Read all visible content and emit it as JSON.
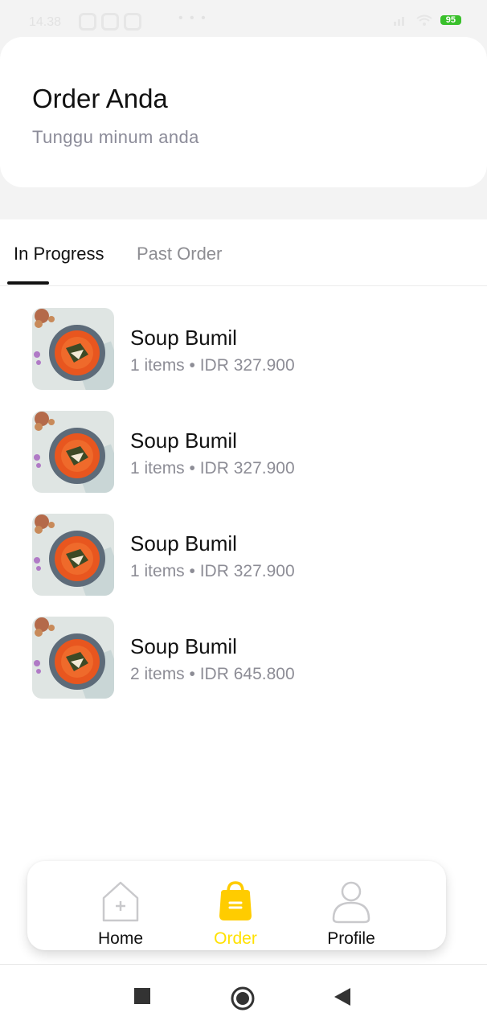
{
  "status_bar": {
    "time": "14.38",
    "overflow": "• • •",
    "battery_level": "95"
  },
  "header": {
    "title": "Order Anda",
    "subtitle": "Tunggu minum anda"
  },
  "tabs": [
    {
      "label": "In Progress",
      "active": true
    },
    {
      "label": "Past Order",
      "active": false
    }
  ],
  "orders": [
    {
      "name": "Soup Bumil",
      "meta": "1 items • IDR 327.900",
      "image": "soup-bowl-photo"
    },
    {
      "name": "Soup Bumil",
      "meta": "1 items • IDR 327.900",
      "image": "soup-bowl-photo"
    },
    {
      "name": "Soup Bumil",
      "meta": "1 items • IDR 327.900",
      "image": "soup-bowl-photo"
    },
    {
      "name": "Soup Bumil",
      "meta": "2 items • IDR 645.800",
      "image": "soup-bowl-photo"
    }
  ],
  "bottom_nav": {
    "items": [
      {
        "label": "Home",
        "icon": "home-icon",
        "active": false
      },
      {
        "label": "Order",
        "icon": "shopping-bag-icon",
        "active": true
      },
      {
        "label": "Profile",
        "icon": "person-icon",
        "active": false
      }
    ]
  },
  "colors": {
    "accent": "#FFCC00",
    "active_label": "#FFE100",
    "text_primary": "#111111",
    "text_secondary": "#8D8D96",
    "background": "#F3F3F3",
    "battery": "#39C02B"
  }
}
